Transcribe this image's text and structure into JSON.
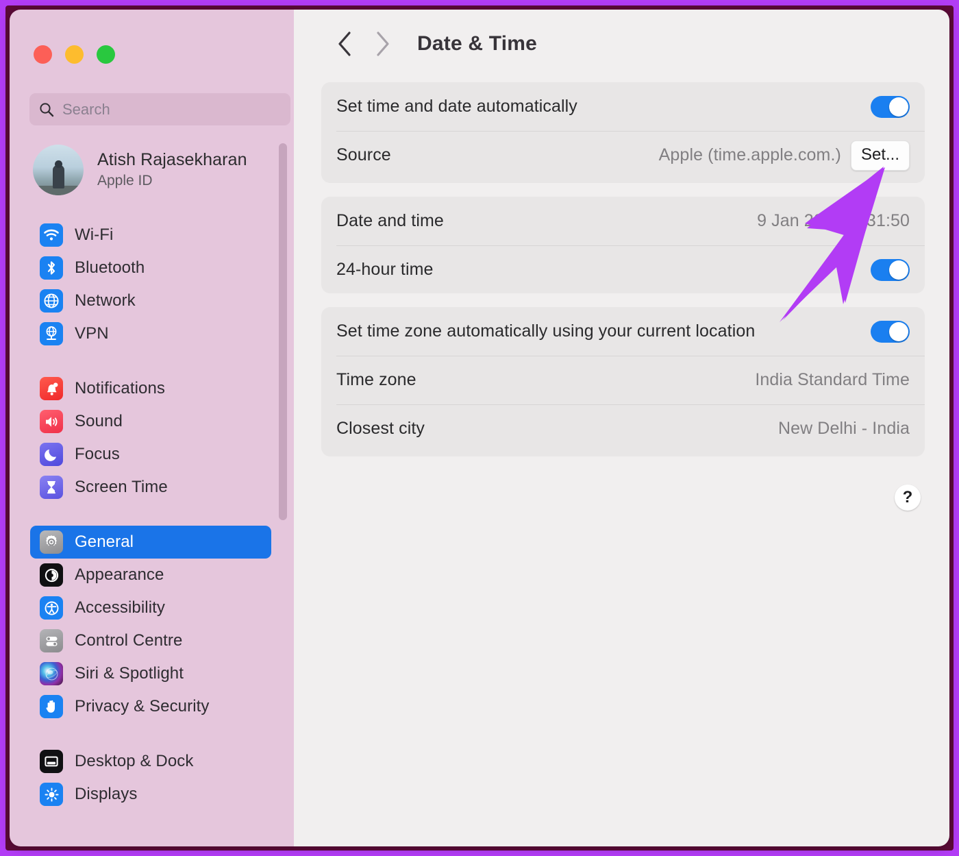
{
  "window": {
    "traffic_lights": [
      "close",
      "minimise",
      "maximise"
    ],
    "colors": {
      "accent_blue": "#1a74e8",
      "toggle_blue": "#1a7ff0",
      "sidebar_bg": "#e5c6dc",
      "detail_bg": "#f1efef",
      "card_bg": "#e8e6e6",
      "annotation_purple": "#b23cf5",
      "annotation_maroon": "#5c0a38"
    }
  },
  "search": {
    "placeholder": "Search",
    "value": "",
    "icon": "search-icon"
  },
  "account": {
    "name": "Atish Rajasekharan",
    "subtitle": "Apple ID",
    "avatar": "user-avatar"
  },
  "sidebar": {
    "groups": [
      {
        "items": [
          {
            "label": "Wi-Fi",
            "icon": "wifi-icon",
            "selected": false
          },
          {
            "label": "Bluetooth",
            "icon": "bluetooth-icon",
            "selected": false
          },
          {
            "label": "Network",
            "icon": "network-globe-icon",
            "selected": false
          },
          {
            "label": "VPN",
            "icon": "vpn-globe-icon",
            "selected": false
          }
        ]
      },
      {
        "items": [
          {
            "label": "Notifications",
            "icon": "bell-icon",
            "selected": false
          },
          {
            "label": "Sound",
            "icon": "speaker-icon",
            "selected": false
          },
          {
            "label": "Focus",
            "icon": "moon-icon",
            "selected": false
          },
          {
            "label": "Screen Time",
            "icon": "hourglass-icon",
            "selected": false
          }
        ]
      },
      {
        "items": [
          {
            "label": "General",
            "icon": "gear-icon",
            "selected": true
          },
          {
            "label": "Appearance",
            "icon": "appearance-icon",
            "selected": false
          },
          {
            "label": "Accessibility",
            "icon": "accessibility-icon",
            "selected": false
          },
          {
            "label": "Control Centre",
            "icon": "control-centre-icon",
            "selected": false
          },
          {
            "label": "Siri & Spotlight",
            "icon": "siri-icon",
            "selected": false
          },
          {
            "label": "Privacy & Security",
            "icon": "privacy-hand-icon",
            "selected": false
          }
        ]
      },
      {
        "items": [
          {
            "label": "Desktop & Dock",
            "icon": "desktop-dock-icon",
            "selected": false
          },
          {
            "label": "Displays",
            "icon": "brightness-icon",
            "selected": false
          }
        ]
      }
    ]
  },
  "toolbar": {
    "back_icon": "chevron-left-icon",
    "forward_icon": "chevron-right-icon",
    "title": "Date & Time"
  },
  "main": {
    "groups": [
      {
        "name": "automatic-time-group",
        "rows": [
          {
            "label": "Set time and date automatically",
            "control": "toggle",
            "toggle_on": true,
            "value": ""
          },
          {
            "label": "Source",
            "control": "value-button",
            "value": "Apple (time.apple.com.)",
            "button_label": "Set..."
          }
        ]
      },
      {
        "name": "date-time-group",
        "rows": [
          {
            "label": "Date and time",
            "control": "value",
            "value": "9 Jan 2024 at  31:50"
          },
          {
            "label": "24-hour time",
            "control": "toggle",
            "toggle_on": true,
            "value": ""
          }
        ]
      },
      {
        "name": "time-zone-group",
        "rows": [
          {
            "label": "Set time zone automatically using your current location",
            "control": "toggle",
            "toggle_on": true,
            "value": ""
          },
          {
            "label": "Time zone",
            "control": "value",
            "value": "India Standard Time"
          },
          {
            "label": "Closest city",
            "control": "value",
            "value": "New Delhi - India"
          }
        ]
      }
    ],
    "help_button_label": "?"
  },
  "annotation": {
    "type": "arrow",
    "color": "#b23cf5",
    "points_at": "set-button"
  }
}
